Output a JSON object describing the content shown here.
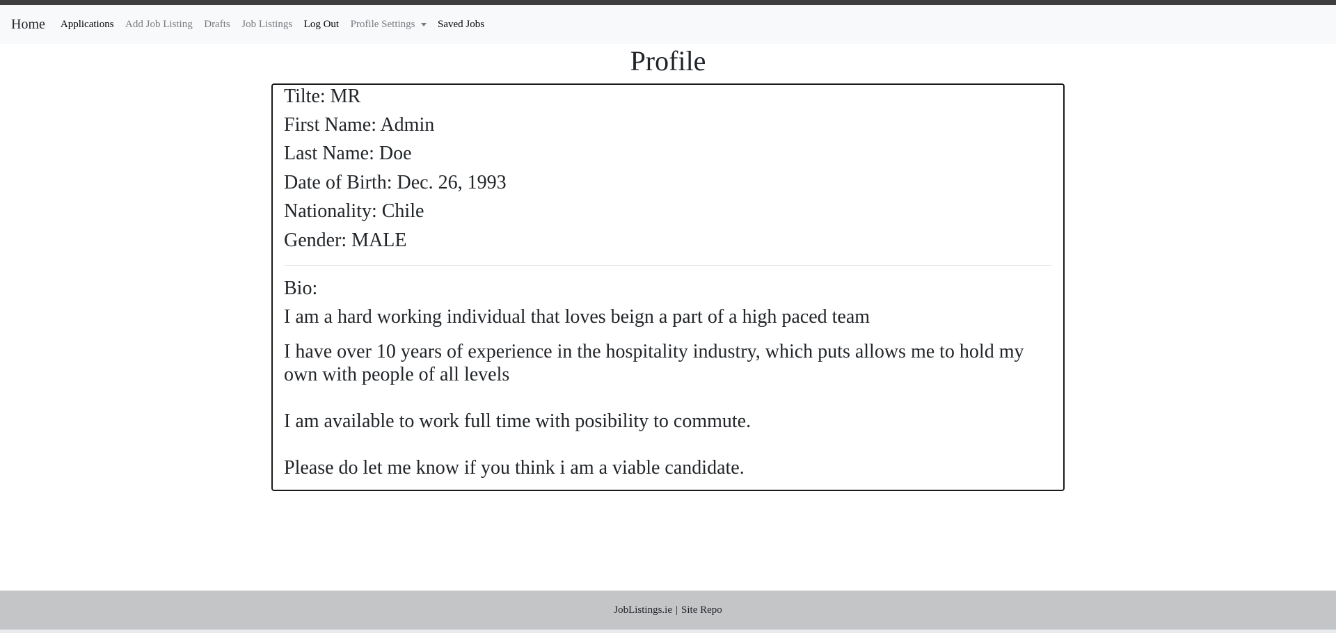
{
  "navbar": {
    "brand": "Home",
    "items": [
      {
        "label": "Applications",
        "state": "active"
      },
      {
        "label": "Add Job Listing",
        "state": "muted"
      },
      {
        "label": "Drafts",
        "state": "muted"
      },
      {
        "label": "Job Listings",
        "state": "muted"
      },
      {
        "label": "Log Out",
        "state": "active"
      },
      {
        "label": "Profile Settings",
        "state": "muted",
        "dropdown": true
      },
      {
        "label": "Saved Jobs",
        "state": "active"
      }
    ]
  },
  "page": {
    "title": "Profile"
  },
  "profile": {
    "title_field": "Tilte: MR",
    "first_name": "First Name: Admin",
    "last_name": "Last Name: Doe",
    "dob": "Date of Birth: Dec. 26, 1993",
    "nationality": "Nationality: Chile",
    "gender": "Gender: MALE",
    "bio_label": "Bio:",
    "bio_lines": [
      "I am a hard working individual that loves beign a part of a high paced team",
      "I have over 10 years of experience in the hospitality industry, which puts allows me to hold my own with people of all levels",
      "I am available to work full time with posibility to commute.",
      "Please do let me know if you think i am a viable candidate."
    ]
  },
  "footer": {
    "site": "JobListings.ie",
    "separator": "|",
    "repo": "Site Repo"
  },
  "colors": {
    "nav_background": "#f8f9fa",
    "footer_background": "#c4c5c7",
    "top_strip": "#3f3f3f",
    "muted_link": "#767b80"
  }
}
